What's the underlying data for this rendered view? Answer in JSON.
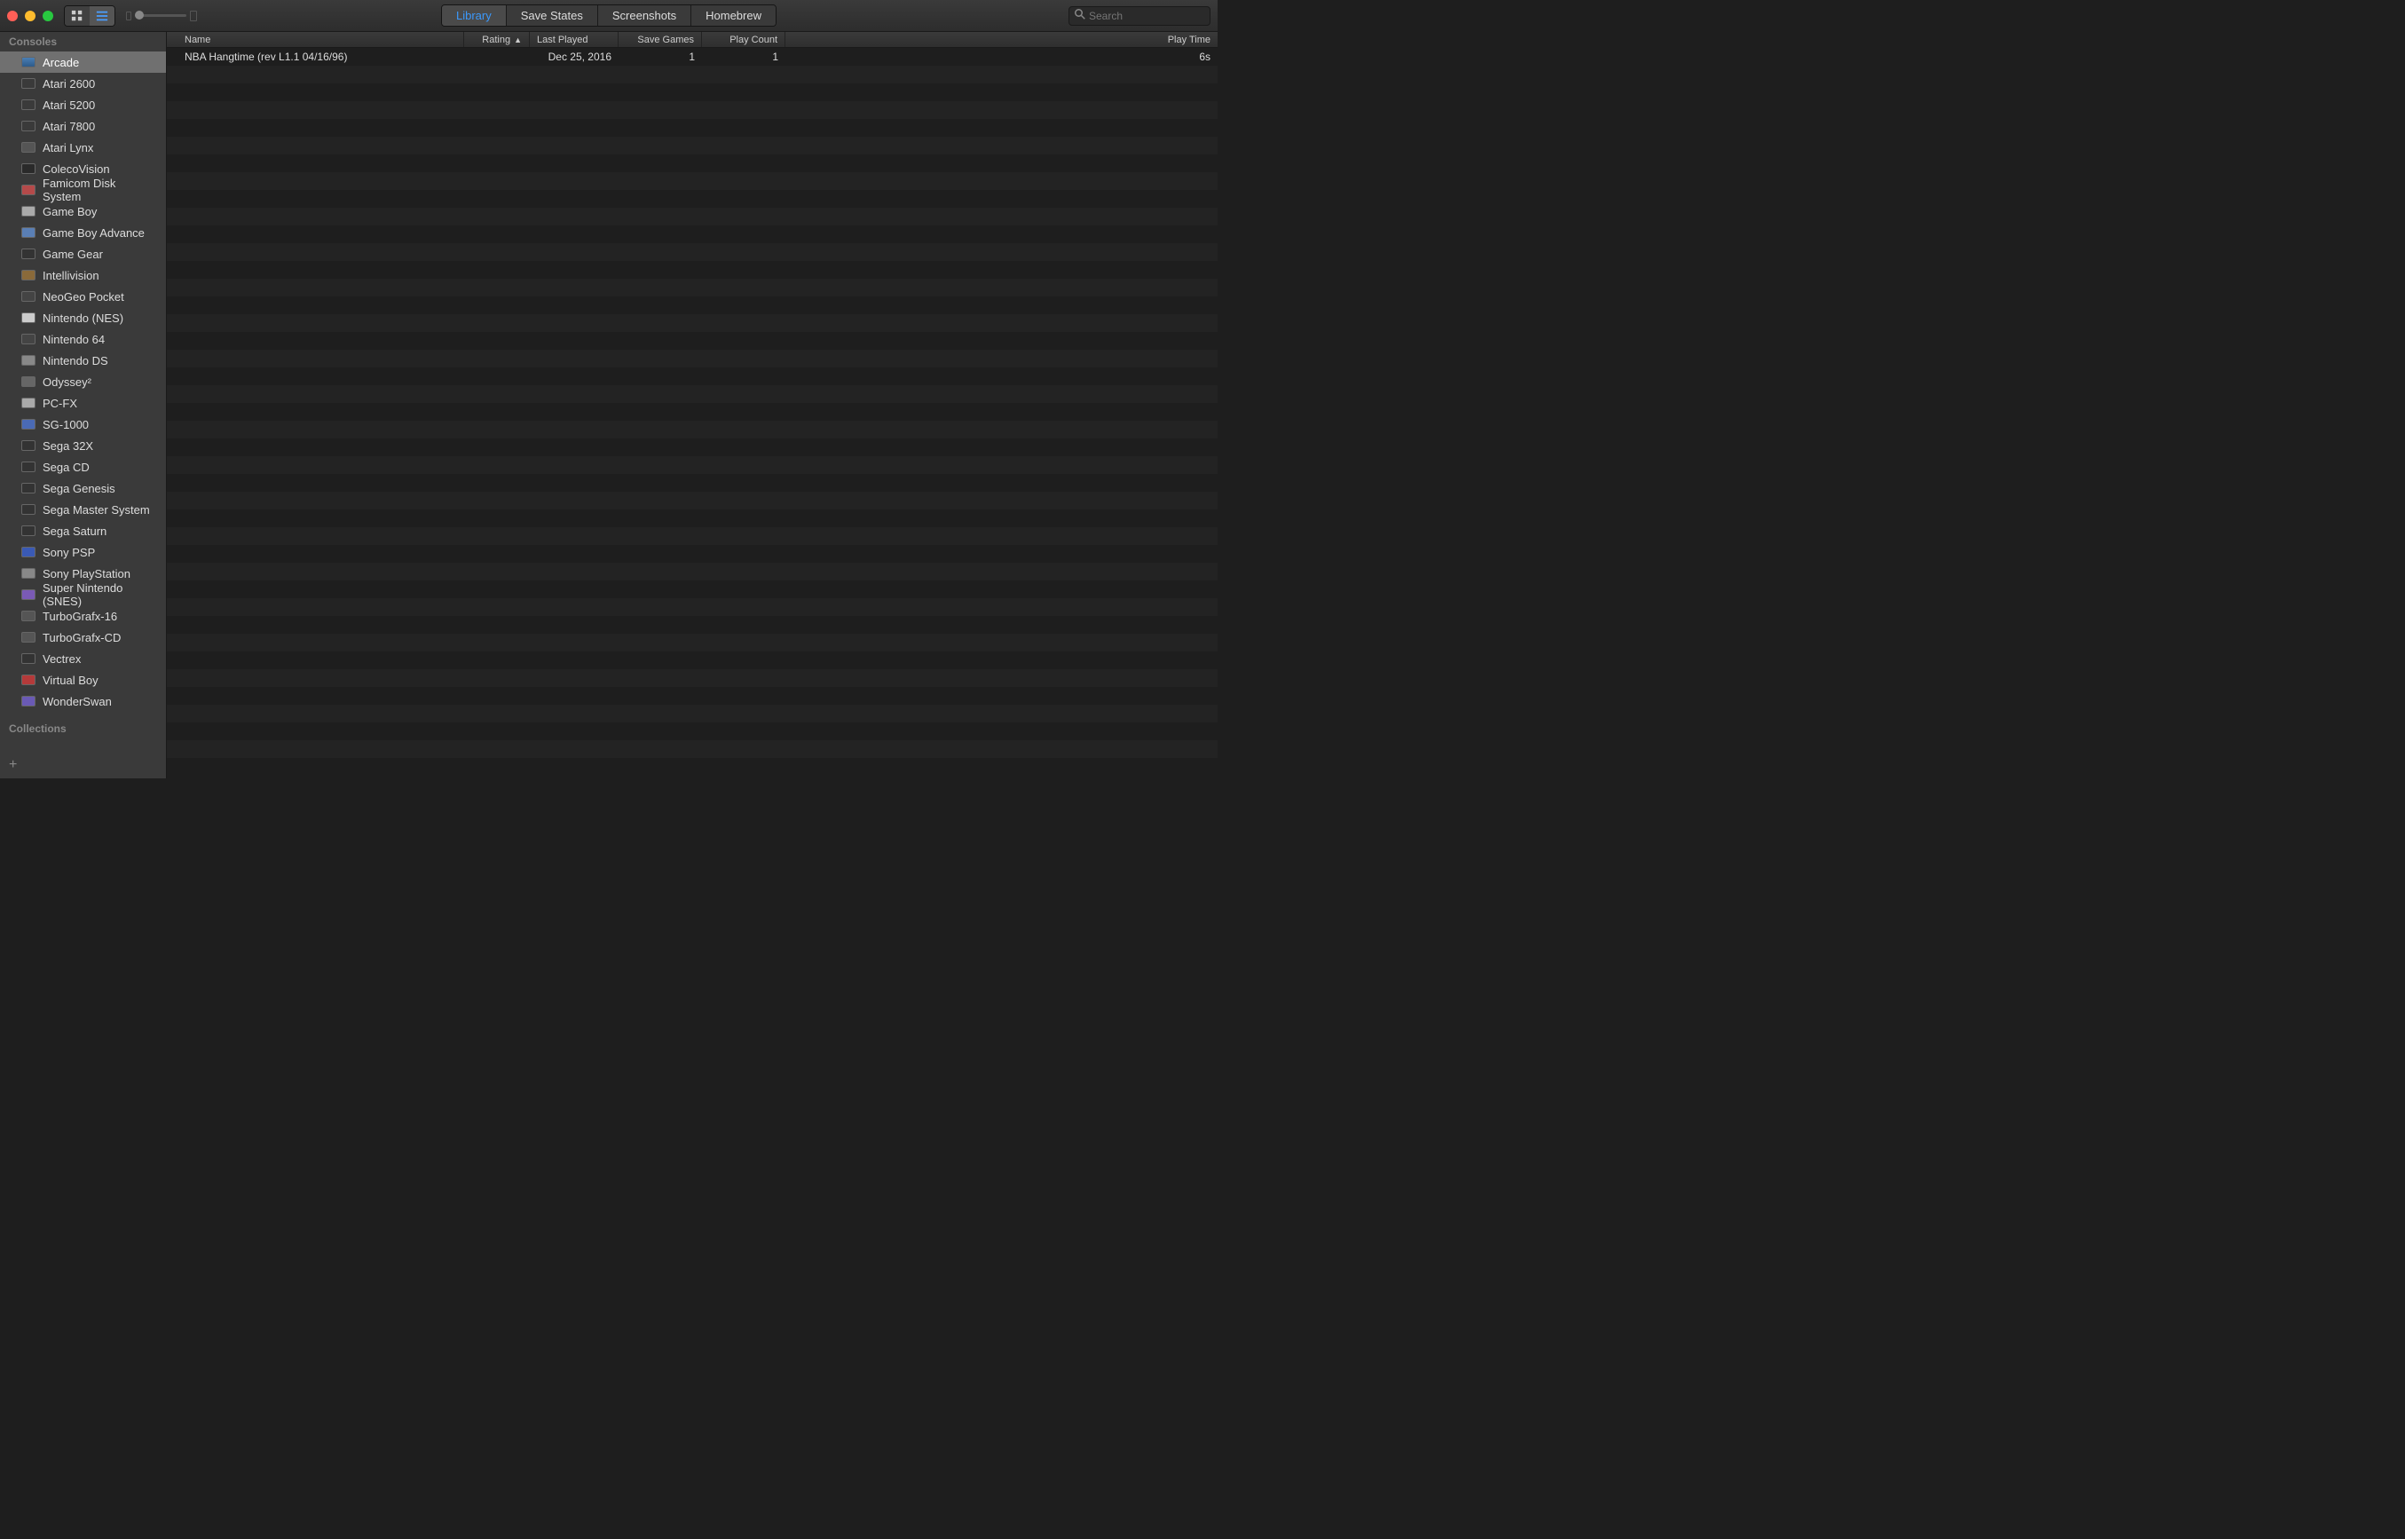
{
  "toolbar": {
    "tabs": [
      "Library",
      "Save States",
      "Screenshots",
      "Homebrew"
    ],
    "active_tab": "Library",
    "search_placeholder": "Search"
  },
  "sidebar": {
    "sections": [
      {
        "title": "Consoles",
        "items": [
          {
            "label": "Arcade",
            "icon": "arcade",
            "selected": true
          },
          {
            "label": "Atari 2600",
            "icon": "atari"
          },
          {
            "label": "Atari 5200",
            "icon": "atari"
          },
          {
            "label": "Atari 7800",
            "icon": "atari"
          },
          {
            "label": "Atari Lynx",
            "icon": "lynx"
          },
          {
            "label": "ColecoVision",
            "icon": "coleco"
          },
          {
            "label": "Famicom Disk System",
            "icon": "famicom"
          },
          {
            "label": "Game Boy",
            "icon": "gb"
          },
          {
            "label": "Game Boy Advance",
            "icon": "gba"
          },
          {
            "label": "Game Gear",
            "icon": "gg"
          },
          {
            "label": "Intellivision",
            "icon": "intv"
          },
          {
            "label": "NeoGeo Pocket",
            "icon": "ngp"
          },
          {
            "label": "Nintendo (NES)",
            "icon": "nes"
          },
          {
            "label": "Nintendo 64",
            "icon": "n64"
          },
          {
            "label": "Nintendo DS",
            "icon": "nds"
          },
          {
            "label": "Odyssey²",
            "icon": "odyssey"
          },
          {
            "label": "PC-FX",
            "icon": "pcfx"
          },
          {
            "label": "SG-1000",
            "icon": "sg1000"
          },
          {
            "label": "Sega 32X",
            "icon": "s32x"
          },
          {
            "label": "Sega CD",
            "icon": "scd"
          },
          {
            "label": "Sega Genesis",
            "icon": "genesis"
          },
          {
            "label": "Sega Master System",
            "icon": "sms"
          },
          {
            "label": "Sega Saturn",
            "icon": "saturn"
          },
          {
            "label": "Sony PSP",
            "icon": "psp"
          },
          {
            "label": "Sony PlayStation",
            "icon": "psx"
          },
          {
            "label": "Super Nintendo (SNES)",
            "icon": "snes"
          },
          {
            "label": "TurboGrafx-16",
            "icon": "tg16"
          },
          {
            "label": "TurboGrafx-CD",
            "icon": "tgcd"
          },
          {
            "label": "Vectrex",
            "icon": "vectrex"
          },
          {
            "label": "Virtual Boy",
            "icon": "vb"
          },
          {
            "label": "WonderSwan",
            "icon": "ws"
          }
        ]
      },
      {
        "title": "Collections",
        "items": []
      }
    ]
  },
  "table": {
    "columns": {
      "name": "Name",
      "rating": "Rating",
      "last_played": "Last Played",
      "save_games": "Save Games",
      "play_count": "Play Count",
      "play_time": "Play Time"
    },
    "sort_column": "rating",
    "sort_direction": "asc",
    "rows": [
      {
        "name": "NBA Hangtime (rev L1.1 04/16/96)",
        "rating": "",
        "last_played": "Dec 25, 2016",
        "save_games": "1",
        "play_count": "1",
        "play_time": "6s"
      }
    ],
    "empty_row_count": 40
  }
}
